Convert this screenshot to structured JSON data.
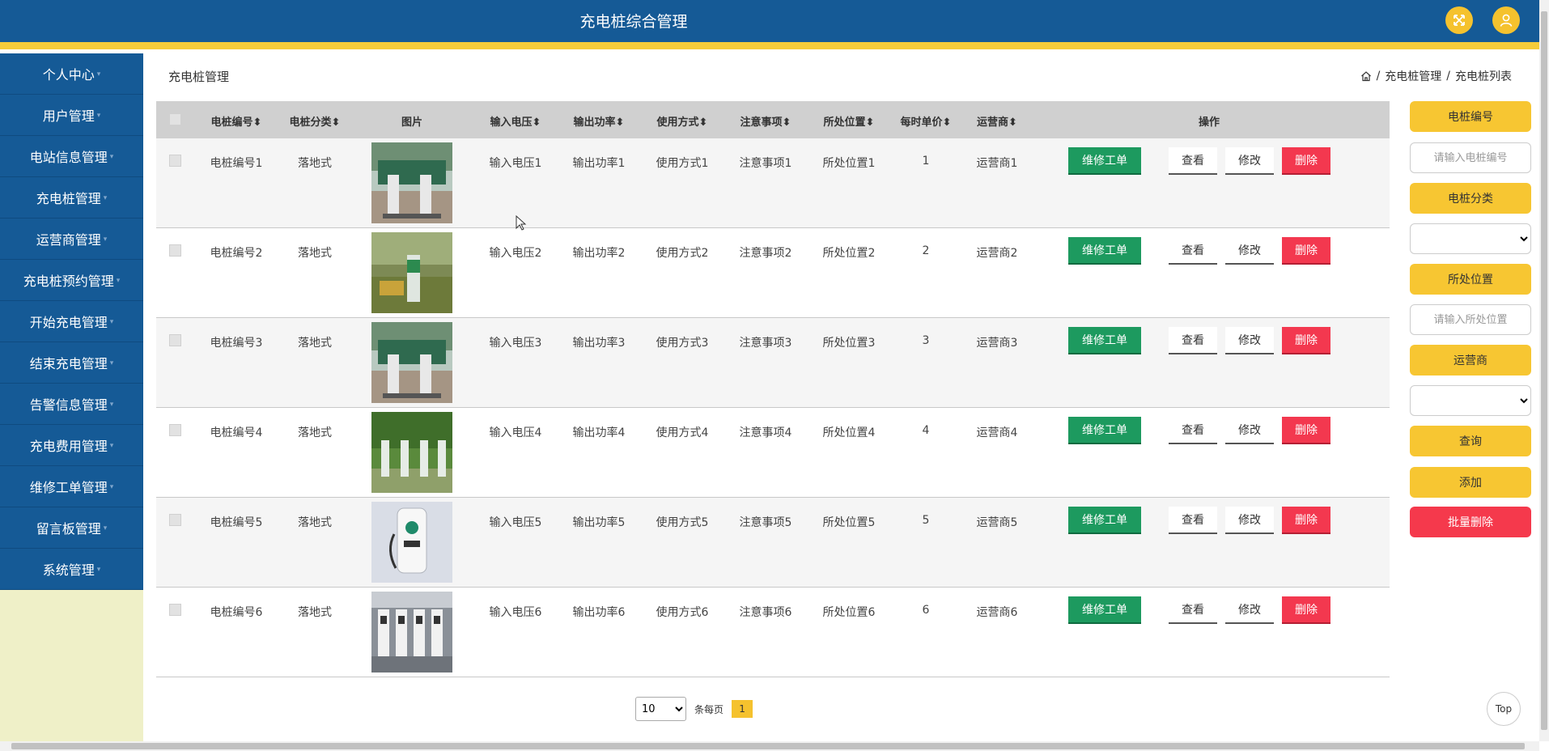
{
  "header": {
    "title": "充电桩综合管理",
    "fullscreen_icon": "expand-icon",
    "user_icon": "user-icon"
  },
  "colors": {
    "primary": "#155a96",
    "accent": "#f5cc3a",
    "repair": "#1d9a5f",
    "danger": "#f3384f",
    "sidebar_bg": "#eff0c8"
  },
  "sidebar": {
    "items": [
      {
        "label": "个人中心"
      },
      {
        "label": "用户管理"
      },
      {
        "label": "电站信息管理"
      },
      {
        "label": "充电桩管理"
      },
      {
        "label": "运营商管理"
      },
      {
        "label": "充电桩预约管理"
      },
      {
        "label": "开始充电管理"
      },
      {
        "label": "结束充电管理"
      },
      {
        "label": "告警信息管理"
      },
      {
        "label": "充电费用管理"
      },
      {
        "label": "维修工单管理"
      },
      {
        "label": "留言板管理"
      },
      {
        "label": "系统管理"
      }
    ]
  },
  "main": {
    "page_title": "充电桩管理",
    "breadcrumb": [
      "充电桩管理",
      "充电桩列表"
    ],
    "breadcrumb_sep": "/"
  },
  "table": {
    "headers": {
      "code": "电桩编号",
      "category": "电桩分类",
      "image": "图片",
      "voltage": "输入电压",
      "power": "输出功率",
      "usage": "使用方式",
      "notes": "注意事项",
      "location": "所处位置",
      "price": "每时单价",
      "operator": "运营商",
      "actions": "操作"
    },
    "sort_glyph": "⬍",
    "rows": [
      {
        "code": "电桩编号1",
        "category": "落地式",
        "voltage": "输入电压1",
        "power": "输出功率1",
        "usage": "使用方式1",
        "notes": "注意事项1",
        "location": "所处位置1",
        "price": "1",
        "operator": "运营商1"
      },
      {
        "code": "电桩编号2",
        "category": "落地式",
        "voltage": "输入电压2",
        "power": "输出功率2",
        "usage": "使用方式2",
        "notes": "注意事项2",
        "location": "所处位置2",
        "price": "2",
        "operator": "运营商2"
      },
      {
        "code": "电桩编号3",
        "category": "落地式",
        "voltage": "输入电压3",
        "power": "输出功率3",
        "usage": "使用方式3",
        "notes": "注意事项3",
        "location": "所处位置3",
        "price": "3",
        "operator": "运营商3"
      },
      {
        "code": "电桩编号4",
        "category": "落地式",
        "voltage": "输入电压4",
        "power": "输出功率4",
        "usage": "使用方式4",
        "notes": "注意事项4",
        "location": "所处位置4",
        "price": "4",
        "operator": "运营商4"
      },
      {
        "code": "电桩编号5",
        "category": "落地式",
        "voltage": "输入电压5",
        "power": "输出功率5",
        "usage": "使用方式5",
        "notes": "注意事项5",
        "location": "所处位置5",
        "price": "5",
        "operator": "运营商5"
      },
      {
        "code": "电桩编号6",
        "category": "落地式",
        "voltage": "输入电压6",
        "power": "输出功率6",
        "usage": "使用方式6",
        "notes": "注意事项6",
        "location": "所处位置6",
        "price": "6",
        "operator": "运营商6"
      }
    ],
    "actions": {
      "repair": "维修工单",
      "view": "查看",
      "edit": "修改",
      "delete": "删除"
    }
  },
  "pagination": {
    "page_size": "10",
    "per_page_label": "条每页",
    "current_page": "1"
  },
  "filters": {
    "code_label": "电桩编号",
    "code_placeholder": "请输入电桩编号",
    "category_label": "电桩分类",
    "category_value": "",
    "location_label": "所处位置",
    "location_placeholder": "请输入所处位置",
    "operator_label": "运营商",
    "operator_value": "",
    "search_button": "查询",
    "add_button": "添加",
    "batch_delete_button": "批量删除"
  },
  "top_button": "Top"
}
